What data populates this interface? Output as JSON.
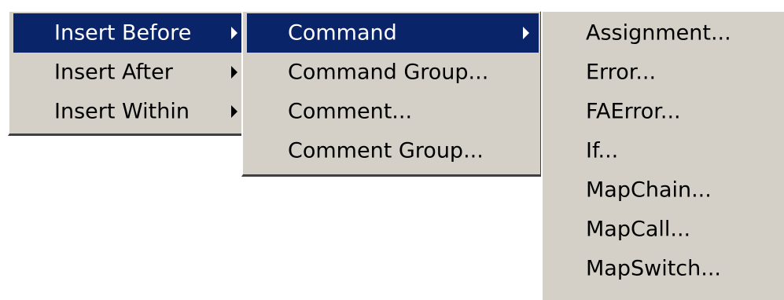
{
  "menu1": {
    "items": [
      {
        "label": "Insert Before"
      },
      {
        "label": "Insert After"
      },
      {
        "label": "Insert Within"
      }
    ]
  },
  "menu2": {
    "items": [
      {
        "label": "Command"
      },
      {
        "label": "Command Group..."
      },
      {
        "label": "Comment..."
      },
      {
        "label": "Comment Group..."
      }
    ]
  },
  "menu3": {
    "items": [
      {
        "label": "Assignment..."
      },
      {
        "label": "Error..."
      },
      {
        "label": "FAError..."
      },
      {
        "label": "If..."
      },
      {
        "label": "MapChain..."
      },
      {
        "label": "MapCall..."
      },
      {
        "label": "MapSwitch..."
      }
    ]
  },
  "colors": {
    "menu_bg": "#d4d0c8",
    "highlight_bg": "#0a246a",
    "highlight_text": "#ffffff"
  },
  "icons": {
    "submenu_arrow": "submenu-arrow-icon"
  }
}
